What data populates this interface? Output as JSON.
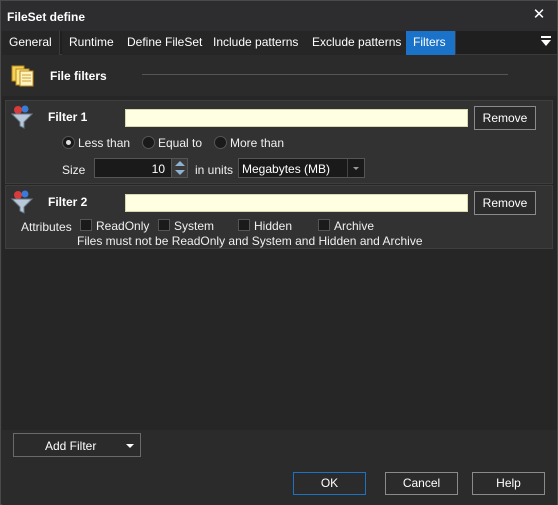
{
  "window": {
    "title": "FileSet define",
    "close_glyph": "✕"
  },
  "tabs": [
    {
      "label": "General",
      "active": false
    },
    {
      "label": "Runtime",
      "active": false
    },
    {
      "label": "Define FileSet",
      "active": false
    },
    {
      "label": "Include patterns",
      "active": false
    },
    {
      "label": "Exclude patterns",
      "active": false
    },
    {
      "label": "Filters",
      "active": true
    }
  ],
  "section": {
    "title": "File filters",
    "icon": "documents-icon"
  },
  "filters": [
    {
      "title": "Filter 1",
      "name_value": "",
      "remove_label": "Remove",
      "icon": "funnel-icon",
      "comparison": [
        {
          "label": "Less than",
          "selected": true
        },
        {
          "label": "Equal to",
          "selected": false
        },
        {
          "label": "More than",
          "selected": false
        }
      ],
      "size_label": "Size",
      "size_value": "10",
      "units_label": "in units",
      "units_value": "Megabytes (MB)"
    },
    {
      "title": "Filter 2",
      "name_value": "",
      "remove_label": "Remove",
      "icon": "funnel-icon",
      "attributes_label": "Attributes",
      "attributes": [
        {
          "label": "ReadOnly",
          "checked": false
        },
        {
          "label": "System",
          "checked": false
        },
        {
          "label": "Hidden",
          "checked": false
        },
        {
          "label": "Archive",
          "checked": false
        }
      ],
      "description": "Files must not be ReadOnly and System and Hidden and Archive"
    }
  ],
  "footer": {
    "add_filter_label": "Add Filter",
    "ok_label": "OK",
    "cancel_label": "Cancel",
    "help_label": "Help"
  },
  "colors": {
    "accent": "#1a73c9",
    "input_bg": "#ffffe1",
    "window_bg": "#2b2b2b"
  }
}
